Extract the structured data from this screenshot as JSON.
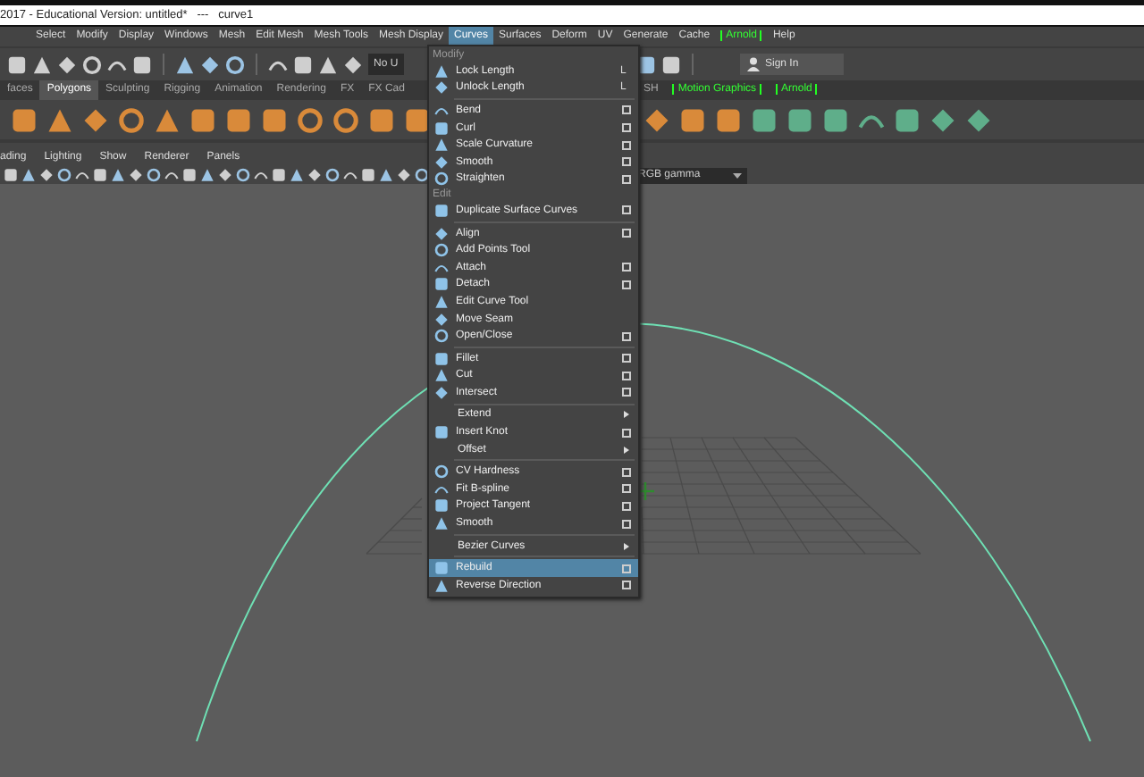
{
  "title_bar": {
    "title": "2017 - Educational Version: untitled*   ---   curve1"
  },
  "menu_bar": [
    {
      "label": "Select",
      "selected": false,
      "highlighted": false
    },
    {
      "label": "Modify",
      "selected": false,
      "highlighted": false
    },
    {
      "label": "Display",
      "selected": false,
      "highlighted": false
    },
    {
      "label": "Windows",
      "selected": false,
      "highlighted": false
    },
    {
      "label": "Mesh",
      "selected": false,
      "highlighted": false
    },
    {
      "label": "Edit Mesh",
      "selected": false,
      "highlighted": false
    },
    {
      "label": "Mesh Tools",
      "selected": false,
      "highlighted": false
    },
    {
      "label": "Mesh Display",
      "selected": false,
      "highlighted": false
    },
    {
      "label": "Curves",
      "selected": true,
      "highlighted": false
    },
    {
      "label": "Surfaces",
      "selected": false,
      "highlighted": false
    },
    {
      "label": "Deform",
      "selected": false,
      "highlighted": false
    },
    {
      "label": "UV",
      "selected": false,
      "highlighted": false
    },
    {
      "label": "Generate",
      "selected": false,
      "highlighted": false
    },
    {
      "label": "Cache",
      "selected": false,
      "highlighted": false
    },
    {
      "label": "Arnold",
      "selected": false,
      "highlighted": true
    },
    {
      "label": "Help",
      "selected": false,
      "highlighted": false
    }
  ],
  "toolbar": {
    "live_field": "No U",
    "sign_in": "Sign In"
  },
  "shelf_tabs": {
    "left": [
      {
        "label": "faces",
        "selected": false,
        "highlighted": false
      },
      {
        "label": "Polygons",
        "selected": true,
        "highlighted": false
      },
      {
        "label": "Sculpting",
        "selected": false,
        "highlighted": false
      },
      {
        "label": "Rigging",
        "selected": false,
        "highlighted": false
      },
      {
        "label": "Animation",
        "selected": false,
        "highlighted": false
      },
      {
        "label": "Rendering",
        "selected": false,
        "highlighted": false
      },
      {
        "label": "FX",
        "selected": false,
        "highlighted": false
      },
      {
        "label": "FX Cad",
        "selected": false,
        "highlighted": false
      }
    ],
    "right": [
      {
        "label": "SH",
        "selected": false,
        "highlighted": false
      },
      {
        "label": "Motion Graphics",
        "selected": false,
        "highlighted": true
      },
      {
        "label": "Arnold",
        "selected": false,
        "highlighted": true
      }
    ]
  },
  "panel_menu": [
    "ading",
    "Lighting",
    "Show",
    "Renderer",
    "Panels"
  ],
  "panel_toolbar": {
    "color_space": "RGB gamma"
  },
  "curves_menu": [
    {
      "kind": "header",
      "label": "Modify"
    },
    {
      "kind": "item",
      "label": "Lock Length",
      "shortcut": "L",
      "option": false,
      "submenu": false,
      "selected": false
    },
    {
      "kind": "item",
      "label": "Unlock Length",
      "shortcut": "L",
      "option": false,
      "submenu": false,
      "selected": false
    },
    {
      "kind": "divider"
    },
    {
      "kind": "item",
      "label": "Bend",
      "option": true,
      "submenu": false,
      "selected": false
    },
    {
      "kind": "item",
      "label": "Curl",
      "option": true,
      "submenu": false,
      "selected": false
    },
    {
      "kind": "item",
      "label": "Scale Curvature",
      "option": true,
      "submenu": false,
      "selected": false
    },
    {
      "kind": "item",
      "label": "Smooth",
      "option": true,
      "submenu": false,
      "selected": false
    },
    {
      "kind": "item",
      "label": "Straighten",
      "option": true,
      "submenu": false,
      "selected": false
    },
    {
      "kind": "header",
      "label": "Edit"
    },
    {
      "kind": "item",
      "label": "Duplicate Surface Curves",
      "option": true,
      "submenu": false,
      "selected": false
    },
    {
      "kind": "divider"
    },
    {
      "kind": "item",
      "label": "Align",
      "option": true,
      "submenu": false,
      "selected": false
    },
    {
      "kind": "item",
      "label": "Add Points Tool",
      "option": false,
      "submenu": false,
      "selected": false
    },
    {
      "kind": "item",
      "label": "Attach",
      "option": true,
      "submenu": false,
      "selected": false
    },
    {
      "kind": "item",
      "label": "Detach",
      "option": true,
      "submenu": false,
      "selected": false
    },
    {
      "kind": "item",
      "label": "Edit Curve Tool",
      "option": false,
      "submenu": false,
      "selected": false
    },
    {
      "kind": "item",
      "label": "Move Seam",
      "option": false,
      "submenu": false,
      "selected": false
    },
    {
      "kind": "item",
      "label": "Open/Close",
      "option": true,
      "submenu": false,
      "selected": false
    },
    {
      "kind": "divider"
    },
    {
      "kind": "item",
      "label": "Fillet",
      "option": true,
      "submenu": false,
      "selected": false
    },
    {
      "kind": "item",
      "label": "Cut",
      "option": true,
      "submenu": false,
      "selected": false
    },
    {
      "kind": "item",
      "label": "Intersect",
      "option": true,
      "submenu": false,
      "selected": false
    },
    {
      "kind": "divider"
    },
    {
      "kind": "item",
      "label": "Extend",
      "option": false,
      "submenu": true,
      "selected": false
    },
    {
      "kind": "item",
      "label": "Insert Knot",
      "option": true,
      "submenu": false,
      "selected": false
    },
    {
      "kind": "item",
      "label": "Offset",
      "option": false,
      "submenu": true,
      "selected": false
    },
    {
      "kind": "divider"
    },
    {
      "kind": "item",
      "label": "CV Hardness",
      "option": true,
      "submenu": false,
      "selected": false
    },
    {
      "kind": "item",
      "label": "Fit B-spline",
      "option": true,
      "submenu": false,
      "selected": false
    },
    {
      "kind": "item",
      "label": "Project Tangent",
      "option": true,
      "submenu": false,
      "selected": false
    },
    {
      "kind": "item",
      "label": "Smooth",
      "option": true,
      "submenu": false,
      "selected": false
    },
    {
      "kind": "divider"
    },
    {
      "kind": "item",
      "label": "Bezier Curves",
      "option": false,
      "submenu": true,
      "selected": false
    },
    {
      "kind": "divider"
    },
    {
      "kind": "item",
      "label": "Rebuild",
      "option": true,
      "submenu": false,
      "selected": true
    },
    {
      "kind": "item",
      "label": "Reverse Direction",
      "option": true,
      "submenu": false,
      "selected": false
    }
  ]
}
